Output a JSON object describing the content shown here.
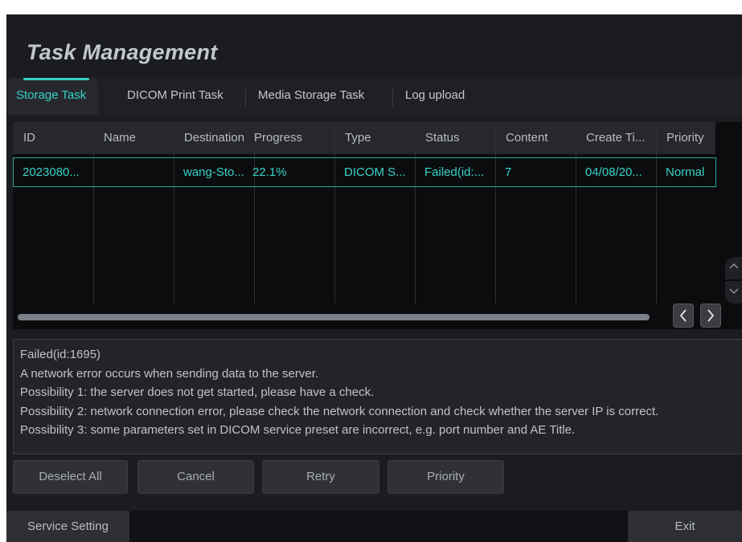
{
  "window": {
    "title": "Task Management"
  },
  "tabs": [
    {
      "label": "Storage Task",
      "active": true
    },
    {
      "label": "DICOM Print Task",
      "active": false
    },
    {
      "label": "Media Storage Task",
      "active": false
    },
    {
      "label": "Log upload",
      "active": false
    }
  ],
  "table": {
    "columns": [
      "ID",
      "Name",
      "Destination",
      "Progress",
      "Type",
      "Status",
      "Content",
      "Create Ti...",
      "Priority"
    ],
    "rows": [
      {
        "id": "2023080...",
        "name": "",
        "destination": "wang-Sto...",
        "progress": "22.1%",
        "type": "DICOM S...",
        "status": "Failed(id:...",
        "content": "7",
        "create_time": "04/08/20...",
        "priority": "Normal"
      }
    ],
    "prev_page_icon": "chevron-left-icon",
    "next_page_icon": "chevron-right-icon",
    "scroll_up_icon": "chevron-up-icon",
    "scroll_down_icon": "chevron-down-icon"
  },
  "message": {
    "lines": [
      "Failed(id:1695)",
      "A network error occurs when sending data to the server.",
      "Possibility 1: the server does not get started, please have a check.",
      "Possibility 2: network connection error, please check the network connection and check whether the server IP is correct.",
      "Possibility 3: some parameters set in DICOM service preset are incorrect, e.g. port number and AE Title."
    ]
  },
  "actions": {
    "deselect_all": "Deselect All",
    "cancel": "Cancel",
    "retry": "Retry",
    "priority": "Priority"
  },
  "footer": {
    "service_setting": "Service Setting",
    "exit": "Exit"
  },
  "colors": {
    "accent": "#36d2c8",
    "background": "#1b1c20",
    "table_background": "#0b0c0e"
  }
}
